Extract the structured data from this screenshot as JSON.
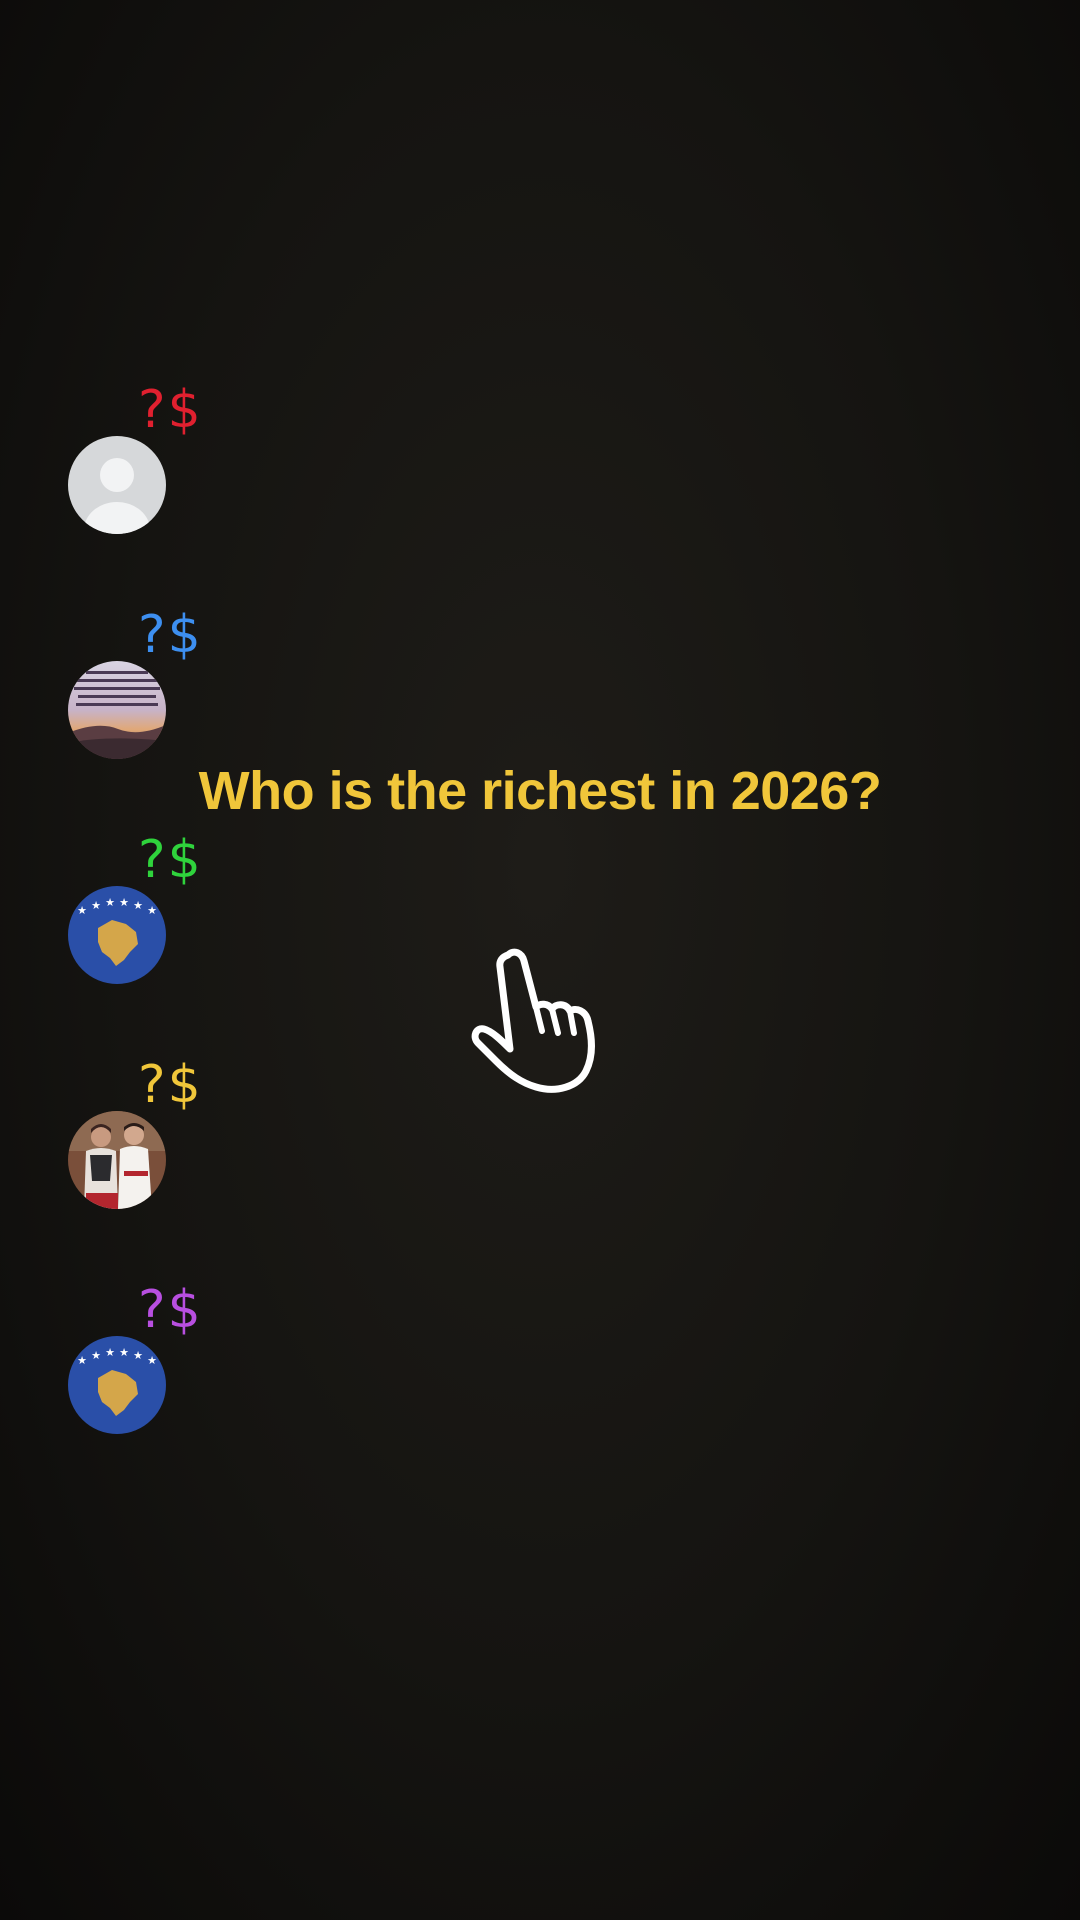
{
  "headline": "Who is the richest in 2026?",
  "colors": {
    "headline": "#f0c63a",
    "background": "#151411"
  },
  "entries": [
    {
      "amount": "?$",
      "color": "#e0202f",
      "avatar": "default-profile"
    },
    {
      "amount": "?$",
      "color": "#3d8ff0",
      "avatar": "sunset-text-photo"
    },
    {
      "amount": "?$",
      "color": "#2fd33c",
      "avatar": "kosovo-flag"
    },
    {
      "amount": "?$",
      "color": "#f0c63a",
      "avatar": "couple-photo"
    },
    {
      "amount": "?$",
      "color": "#b84fe0",
      "avatar": "kosovo-flag"
    }
  ],
  "pointer_icon": "hand-pointer-icon"
}
